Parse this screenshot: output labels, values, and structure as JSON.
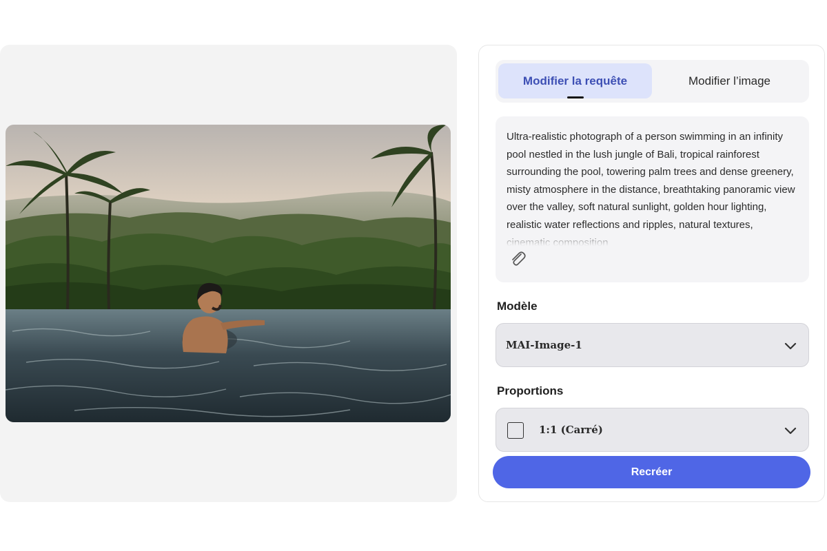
{
  "tabs": {
    "edit_prompt": "Modifier la requête",
    "edit_image": "Modifier l’image"
  },
  "prompt": {
    "text": "Ultra-realistic photograph of a person swimming in an infinity pool nestled in the lush jungle of Bali, tropical rainforest surrounding the pool, towering palm trees and dense greenery, misty atmosphere in the distance, breathtaking panoramic view over the valley, soft natural sunlight, golden hour lighting, realistic water reflections and ripples, natural textures, cinematic composition"
  },
  "model": {
    "label": "Modèle",
    "value": "MAI-Image-1"
  },
  "aspect": {
    "label": "Proportions",
    "value": "1:1 (Carré)"
  },
  "actions": {
    "recreate": "Recréer"
  },
  "colors": {
    "accent": "#4f66e6",
    "tab_active_bg": "#dde3fb",
    "tab_active_text": "#3d4fb4"
  },
  "icons": {
    "attach": "paperclip-icon",
    "dropdown": "chevron-down-icon",
    "ratio": "square-ratio-icon"
  }
}
